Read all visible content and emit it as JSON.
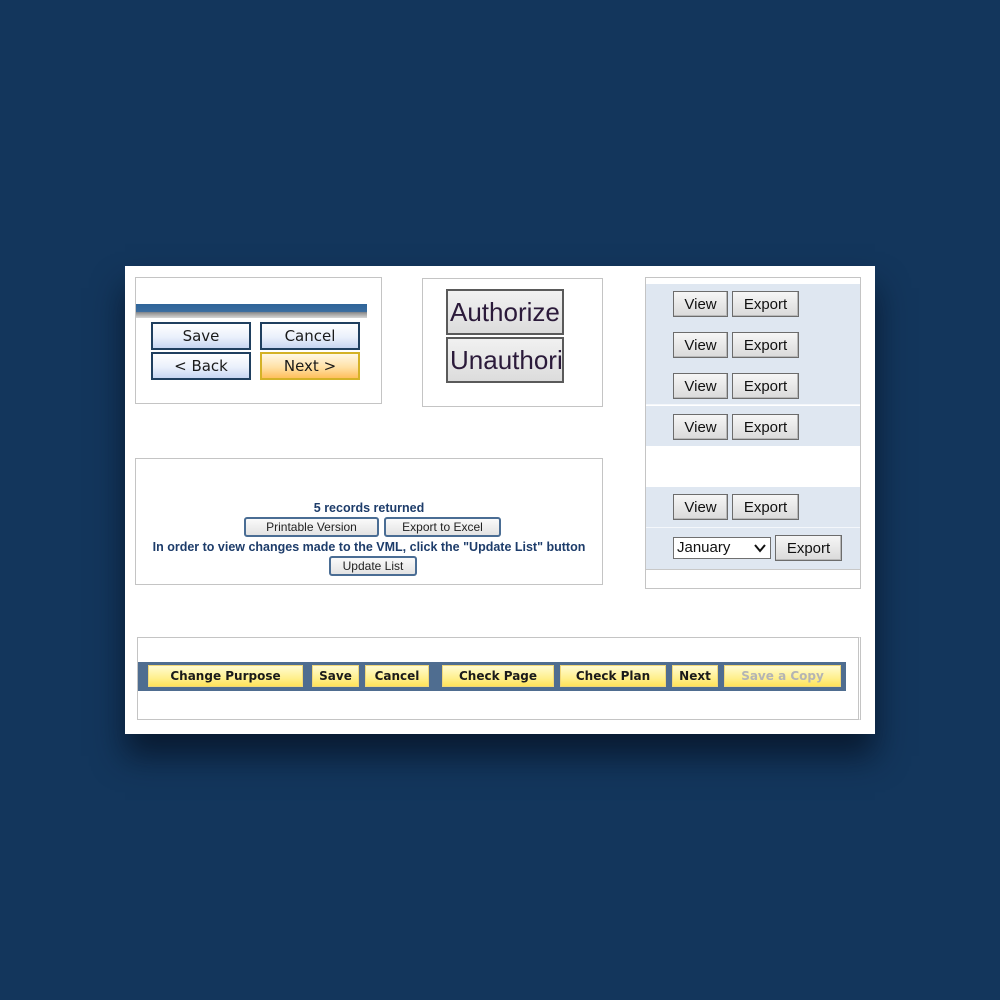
{
  "panel_nav": {
    "save": "Save",
    "cancel": "Cancel",
    "back": "< Back",
    "next": "Next >"
  },
  "panel_auth": {
    "authorize": "Authorize",
    "unauthorize": "Unauthori"
  },
  "panel_export": {
    "rows": [
      {
        "view": "View",
        "export": "Export"
      },
      {
        "view": "View",
        "export": "Export"
      },
      {
        "view": "View",
        "export": "Export"
      },
      {
        "view": "View",
        "export": "Export"
      },
      {
        "view": "View",
        "export": "Export"
      }
    ],
    "month_select": {
      "value": "January"
    },
    "month_export": "Export",
    "chevron_icon": "⌄"
  },
  "panel_records": {
    "count_text": "5 records returned",
    "printable": "Printable Version",
    "export_excel": "Export to Excel",
    "instruction": "In order to view changes made to the VML, click the \"Update List\" button",
    "update_list": "Update List"
  },
  "toolbar": {
    "change_purpose": "Change Purpose",
    "save": "Save",
    "cancel": "Cancel",
    "check_page": "Check Page",
    "check_plan": "Check Plan",
    "next": "Next",
    "save_copy": "Save a Copy"
  }
}
